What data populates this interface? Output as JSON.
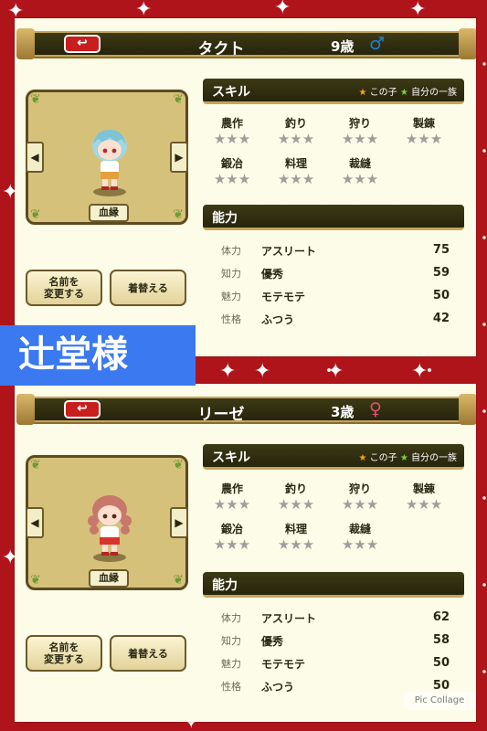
{
  "panels": [
    {
      "name": "タクト",
      "age": "9歳",
      "gender_symbol": "♂",
      "gender_color": "#1f7fd8",
      "back_icon": "↩",
      "skills_title": "スキル",
      "legend_this_child": "この子",
      "legend_clan": "自分の一族",
      "skills": [
        {
          "name": "農作",
          "stars": "★★★"
        },
        {
          "name": "釣り",
          "stars": "★★★"
        },
        {
          "name": "狩り",
          "stars": "★★★"
        },
        {
          "name": "製錬",
          "stars": "★★★"
        },
        {
          "name": "鍛冶",
          "stars": "★★★"
        },
        {
          "name": "料理",
          "stars": "★★★"
        },
        {
          "name": "裁縫",
          "stars": "★★★"
        }
      ],
      "ability_title": "能力",
      "stats": [
        {
          "label": "体力",
          "value": "アスリート",
          "num": "75"
        },
        {
          "label": "知力",
          "value": "優秀",
          "num": "59"
        },
        {
          "label": "魅力",
          "value": "モテモテ",
          "num": "50"
        },
        {
          "label": "性格",
          "value": "ふつう",
          "num": "42"
        }
      ],
      "bloodline_label": "血縁",
      "rename_label": "名前を\n変更する",
      "dress_label": "着替える",
      "arrow_left": "◀",
      "arrow_right": "▶"
    },
    {
      "name": "リーゼ",
      "age": "3歳",
      "gender_symbol": "♀",
      "gender_color": "#e3506f",
      "back_icon": "↩",
      "skills_title": "スキル",
      "legend_this_child": "この子",
      "legend_clan": "自分の一族",
      "skills": [
        {
          "name": "農作",
          "stars": "★★★"
        },
        {
          "name": "釣り",
          "stars": "★★★"
        },
        {
          "name": "狩り",
          "stars": "★★★"
        },
        {
          "name": "製錬",
          "stars": "★★★"
        },
        {
          "name": "鍛冶",
          "stars": "★★★"
        },
        {
          "name": "料理",
          "stars": "★★★"
        },
        {
          "name": "裁縫",
          "stars": "★★★"
        }
      ],
      "ability_title": "能力",
      "stats": [
        {
          "label": "体力",
          "value": "アスリート",
          "num": "62"
        },
        {
          "label": "知力",
          "value": "優秀",
          "num": "58"
        },
        {
          "label": "魅力",
          "value": "モテモテ",
          "num": "50"
        },
        {
          "label": "性格",
          "value": "ふつう",
          "num": "50"
        }
      ],
      "bloodline_label": "血縁",
      "rename_label": "名前を\n変更する",
      "dress_label": "着替える",
      "arrow_left": "◀",
      "arrow_right": "▶"
    }
  ],
  "overlay_tag": "辻堂様",
  "watermark": "Pic Collage",
  "colors": {
    "background": "#b0141b",
    "panel": "#fdfce8",
    "header": "#2f2d12",
    "tag": "#3a79f0"
  }
}
